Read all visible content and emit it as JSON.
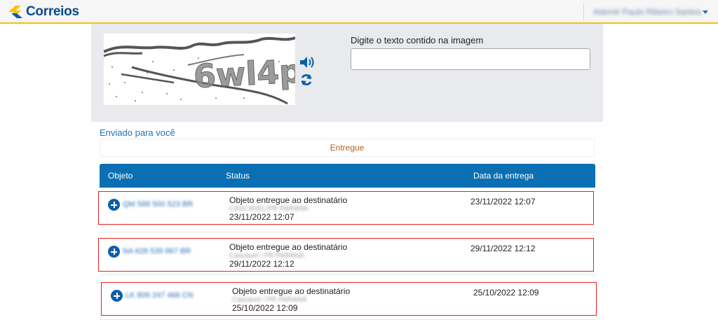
{
  "header": {
    "logo_text": "Correios",
    "user_name": "Ademir Paulo Ribeiro Santos",
    "user_menu_icon": "caret-down-icon"
  },
  "captcha": {
    "text": "6wl4p",
    "audio_icon": "speaker-icon",
    "refresh_icon": "refresh-icon",
    "prompt_label": "Digite o texto contido na imagem",
    "input_value": ""
  },
  "sent": {
    "title": "Enviado para você",
    "filter_label": "Entregue",
    "columns": [
      "Objeto",
      "Status",
      "Data da entrega"
    ],
    "rows": [
      {
        "code": "QM 588 500 523 BR",
        "status": "Objeto entregue ao destinatário",
        "location": "CASCAVEL/PR PARANÁ",
        "datetime": "23/11/2022 12:07",
        "delivery_date": "23/11/2022 12:07"
      },
      {
        "code": "NA 628 539 867 BR",
        "status": "Objeto entregue ao destinatário",
        "location": "Cascavel / PR PARANÁ",
        "datetime": "29/11/2022 12:12",
        "delivery_date": "29/11/2022 12:12"
      },
      {
        "code": "LK 806 247 466 CN",
        "status": "Objeto entregue ao destinatário",
        "location": "Cascavel / PR PARANÁ",
        "datetime": "25/10/2022 12:09",
        "delivery_date": "25/10/2022 12:09"
      }
    ]
  },
  "colors": {
    "brand_blue": "#0a6fb3",
    "brand_yellow": "#f5c400",
    "highlight_border": "#e32222",
    "filter_text": "#b65f1e"
  }
}
